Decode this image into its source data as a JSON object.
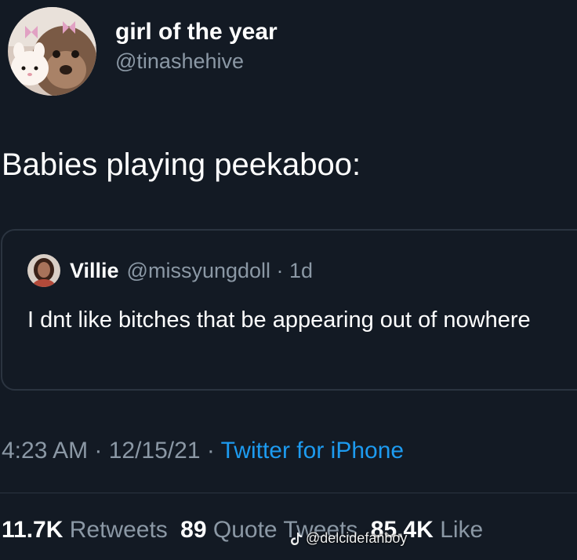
{
  "tweet": {
    "author": {
      "name": "girl of the year",
      "handle": "@tinashehive"
    },
    "text": "Babies playing peekaboo:",
    "quote": {
      "name": "Villie",
      "handle_time": "@missyungdoll · 1d",
      "text": "I dnt like bitches that be appearing out of nowhere"
    },
    "meta": {
      "time_date": "4:23 AM · 12/15/21 · ",
      "source": "Twitter for iPhone"
    },
    "stats": {
      "retweets_count": "11.7K",
      "retweets_label": "Retweets",
      "quotes_count": "89",
      "quotes_label": "Quote Tweets",
      "likes_count": "85.4K",
      "likes_label": "Like"
    }
  },
  "watermark": {
    "text": "@delcidefanboy",
    "icon": "tiktok-icon"
  },
  "colors": {
    "background": "#131a24",
    "text_primary": "#ffffff",
    "text_secondary": "#8b98a5",
    "accent": "#1d9bf0",
    "border": "#2b3440"
  }
}
